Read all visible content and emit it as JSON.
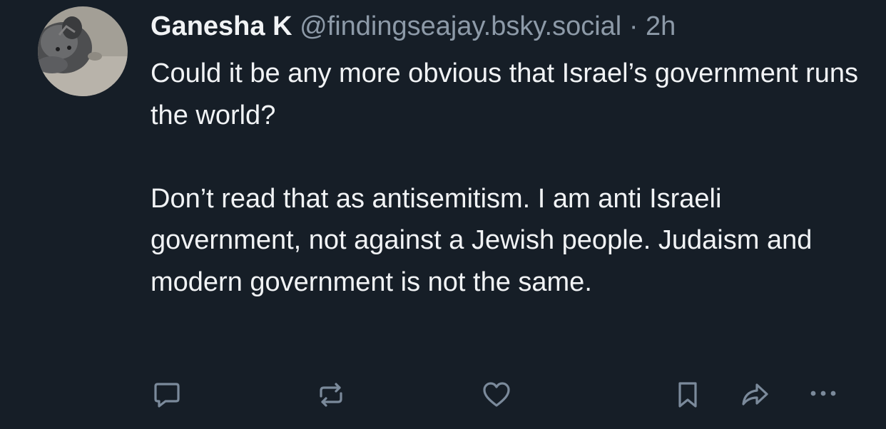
{
  "post": {
    "author_name": "Ganesha K",
    "handle": "@findingseajay.bsky.social",
    "separator": "·",
    "time": "2h",
    "paragraphs": [
      "Could it be any more obvious that Israel’s government runs the world?",
      "Don’t read that as antisemitism. I am anti Israeli government, not against a Jewish people. Judaism and modern government is not the same."
    ]
  },
  "actions": [
    {
      "icon": "reply-icon"
    },
    {
      "icon": "repost-icon"
    },
    {
      "icon": "like-icon"
    },
    {
      "icon": "bookmark-icon"
    },
    {
      "icon": "share-icon"
    },
    {
      "icon": "more-icon"
    }
  ],
  "colors": {
    "background": "#161e27",
    "text_primary": "#f1f3f5",
    "text_secondary": "#8d9aa8",
    "icon": "#7b8a9b"
  }
}
